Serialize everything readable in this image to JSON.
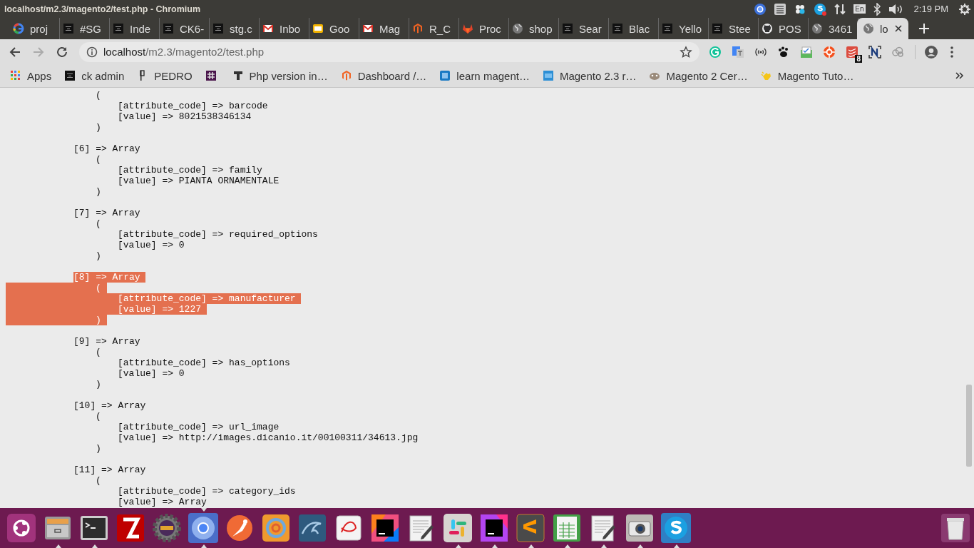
{
  "window": {
    "title": "localhost/m2.3/magento2/test.php - Chromium"
  },
  "top_panel": {
    "keyboard_layout": "En",
    "clock": "2:19 PM"
  },
  "tabs": [
    {
      "label": "proj",
      "kind": "google",
      "selected": false
    },
    {
      "label": "#SG",
      "kind": "charles",
      "selected": false
    },
    {
      "label": "Inde",
      "kind": "charles",
      "selected": false
    },
    {
      "label": "CK6-",
      "kind": "charles",
      "selected": false
    },
    {
      "label": "stg.c",
      "kind": "charles",
      "selected": false
    },
    {
      "label": "Inbo",
      "kind": "gmail",
      "selected": false
    },
    {
      "label": "Goo",
      "kind": "slides",
      "selected": false
    },
    {
      "label": "Mag",
      "kind": "gmail",
      "selected": false
    },
    {
      "label": "R_C",
      "kind": "magento",
      "selected": false
    },
    {
      "label": "Proc",
      "kind": "gitlab",
      "selected": false
    },
    {
      "label": "shop",
      "kind": "globe",
      "selected": false
    },
    {
      "label": "Sear",
      "kind": "charles",
      "selected": false
    },
    {
      "label": "Blac",
      "kind": "charles",
      "selected": false
    },
    {
      "label": "Yello",
      "kind": "charles",
      "selected": false
    },
    {
      "label": "Stee",
      "kind": "charles",
      "selected": false
    },
    {
      "label": "POS",
      "kind": "github",
      "selected": false
    },
    {
      "label": "3461",
      "kind": "globe",
      "selected": false
    },
    {
      "label": "lo",
      "kind": "globe",
      "selected": true
    }
  ],
  "address_bar": {
    "host": "localhost",
    "path": "/m2.3/magento2/test.php"
  },
  "extensions": [
    {
      "kind": "grammarly"
    },
    {
      "kind": "translate"
    },
    {
      "kind": "radio"
    },
    {
      "kind": "paw"
    },
    {
      "kind": "mail"
    },
    {
      "kind": "orange"
    },
    {
      "kind": "todoist",
      "badge": "8"
    },
    {
      "kind": "note"
    },
    {
      "kind": "cloud"
    }
  ],
  "bookmarks": [
    {
      "label": "Apps",
      "kind": "apps"
    },
    {
      "label": "ck admin",
      "kind": "charles"
    },
    {
      "label": "PEDRO",
      "kind": "pedro"
    },
    {
      "kind": "slack"
    },
    {
      "label": "Php version in…",
      "kind": "typo"
    },
    {
      "label": "Dashboard /…",
      "kind": "magento"
    },
    {
      "label": "learn magent…",
      "kind": "mblue"
    },
    {
      "label": "Magento 2.3 r…",
      "kind": "ub"
    },
    {
      "label": "Magento 2 Cer…",
      "kind": "otter"
    },
    {
      "label": "Magento Tuto…",
      "kind": "hand"
    }
  ],
  "print_r": {
    "entries": [
      {
        "open": "(",
        "lines": [
          "[attribute_code] => barcode",
          "[value] => 8021538346134"
        ],
        "close": ")",
        "selected": false
      },
      {
        "header": "[6] => Array",
        "open": "(",
        "lines": [
          "[attribute_code] => family",
          "[value] => PIANTA ORNAMENTALE"
        ],
        "close": ")",
        "selected": false
      },
      {
        "header": "[7] => Array",
        "open": "(",
        "lines": [
          "[attribute_code] => required_options",
          "[value] => 0"
        ],
        "close": ")",
        "selected": false
      },
      {
        "header": "[8] => Array",
        "open": "(",
        "lines": [
          "[attribute_code] => manufacturer",
          "[value] => 1227"
        ],
        "close": ")",
        "selected": true
      },
      {
        "header": "[9] => Array",
        "open": "(",
        "lines": [
          "[attribute_code] => has_options",
          "[value] => 0"
        ],
        "close": ")",
        "selected": false
      },
      {
        "header": "[10] => Array",
        "open": "(",
        "lines": [
          "[attribute_code] => url_image",
          "[value] => http://images.dicanio.it/00100311/34613.jpg"
        ],
        "close": ")",
        "selected": false
      },
      {
        "header": "[11] => Array",
        "open": "(",
        "lines": [
          "[attribute_code] => category_ids",
          "[value] => Array"
        ],
        "selected": false
      }
    ]
  },
  "dock": [
    {
      "kind": "ubuntu",
      "running": false,
      "focused": false
    },
    {
      "kind": "files",
      "running": true,
      "focused": false
    },
    {
      "kind": "terminal",
      "running": true,
      "focused": false
    },
    {
      "kind": "filezilla",
      "running": false,
      "focused": false
    },
    {
      "kind": "gear",
      "running": false,
      "focused": false
    },
    {
      "kind": "chromium",
      "running": true,
      "focused": true
    },
    {
      "kind": "postman",
      "running": false,
      "focused": false
    },
    {
      "kind": "meld",
      "running": false,
      "focused": false
    },
    {
      "kind": "database",
      "running": false,
      "focused": false
    },
    {
      "kind": "viewer",
      "running": false,
      "focused": false
    },
    {
      "kind": "intellij",
      "running": false,
      "focused": false
    },
    {
      "kind": "editor",
      "running": false,
      "focused": false
    },
    {
      "kind": "slack",
      "running": true,
      "focused": false
    },
    {
      "kind": "phpstorm",
      "running": true,
      "focused": false
    },
    {
      "kind": "sublime",
      "running": true,
      "focused": false
    },
    {
      "kind": "calc",
      "running": true,
      "focused": false
    },
    {
      "kind": "editor",
      "running": true,
      "focused": false
    },
    {
      "kind": "camera",
      "running": true,
      "focused": false
    },
    {
      "kind": "skype",
      "running": true,
      "focused": false
    }
  ]
}
